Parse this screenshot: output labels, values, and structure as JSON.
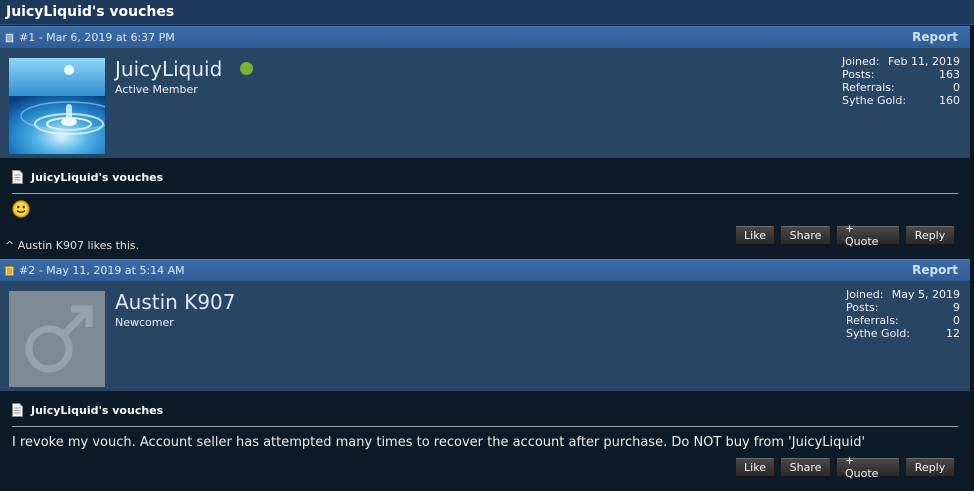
{
  "thread": {
    "title": "JuicyLiquid's vouches"
  },
  "posts": [
    {
      "meta": "#1 - Mar 6, 2019 at 6:37 PM",
      "report_label": "Report",
      "username": "JuicyLiquid",
      "user_title": "Active Member",
      "online": true,
      "stats": {
        "joined_label": "Joined:",
        "joined_value": "Feb 11, 2019",
        "posts_label": "Posts:",
        "posts_value": "163",
        "referrals_label": "Referrals:",
        "referrals_value": "0",
        "gold_label": "Sythe Gold:",
        "gold_value": "160"
      },
      "message_title": "JuicyLiquid's vouches",
      "message_body": "",
      "likes_text": "^ Austin K907 likes this.",
      "buttons": {
        "like": "Like",
        "share": "Share",
        "quote": "+ Quote",
        "reply": "Reply"
      }
    },
    {
      "meta": "#2 - May 11, 2019 at 5:14 AM",
      "report_label": "Report",
      "username": "Austin K907",
      "user_title": "Newcomer",
      "online": false,
      "stats": {
        "joined_label": "Joined:",
        "joined_value": "May 5, 2019",
        "posts_label": "Posts:",
        "posts_value": "9",
        "referrals_label": "Referrals:",
        "referrals_value": "0",
        "gold_label": "Sythe Gold:",
        "gold_value": "12"
      },
      "message_title": "JuicyLiquid's vouches",
      "message_body": "I revoke my vouch. Account seller has attempted many times to recover the account after purchase. Do NOT buy from 'JuicyLiquid'",
      "buttons": {
        "like": "Like",
        "share": "Share",
        "quote": "+ Quote",
        "reply": "Reply"
      }
    }
  ],
  "icons": {
    "post_icon_1": "document-icon",
    "post_icon_2": "document-new-icon",
    "message_icon": "page-icon",
    "smiley": "smiley-icon",
    "online_status": "online-status-dot",
    "default_avatar": "male-symbol-avatar"
  },
  "colors": {
    "header_bar": "#1d3a5c",
    "post_bar": "#3b6ca8",
    "user_panel": "#284563",
    "content_bg": "#0d1a27",
    "online_dot": "#7ab32e"
  }
}
